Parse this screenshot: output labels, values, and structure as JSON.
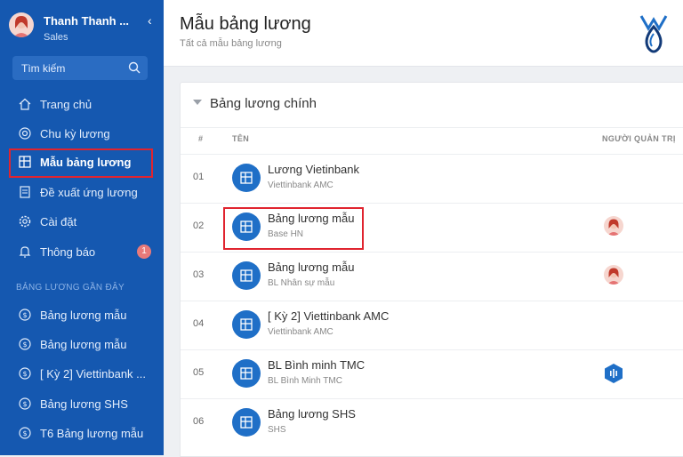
{
  "sidebar": {
    "user_name": "Thanh Thanh ...",
    "user_role": "Sales",
    "search_placeholder": "Tìm kiếm",
    "nav": [
      {
        "label": "Trang chủ",
        "icon": "home-icon"
      },
      {
        "label": "Chu kỳ lương",
        "icon": "cycle-icon"
      },
      {
        "label": "Mẫu bảng lương",
        "icon": "table-icon"
      },
      {
        "label": "Đề xuất ứng lương",
        "icon": "document-icon"
      },
      {
        "label": "Cài đặt",
        "icon": "gear-icon"
      },
      {
        "label": "Thông báo",
        "icon": "bell-icon",
        "badge": "1"
      }
    ],
    "recent_title": "BẢNG LƯƠNG GẦN ĐÂY",
    "recent": [
      {
        "label": "Bảng lương mẫu",
        "icon": "dollar-icon"
      },
      {
        "label": "Bảng lương mẫu",
        "icon": "dollar-icon"
      },
      {
        "label": "[ Kỳ 2] Viettinbank ...",
        "icon": "dollar-icon"
      },
      {
        "label": "Bảng lương SHS",
        "icon": "dollar-icon"
      },
      {
        "label": "T6 Bảng lương mẫu",
        "icon": "dollar-icon"
      }
    ]
  },
  "header": {
    "title": "Mẫu bảng lương",
    "subtitle": "Tất cả mẫu bảng lương"
  },
  "card": {
    "title": "Bảng lương chính",
    "columns": {
      "no": "#",
      "name": "TÊN",
      "admin": "NGƯỜI QUẢN TRỊ"
    },
    "rows": [
      {
        "no": "01",
        "name": "Lương Vietinbank",
        "sub": "Viettinbank AMC",
        "admin": ""
      },
      {
        "no": "02",
        "name": "Bảng lương mẫu",
        "sub": "Base HN",
        "admin": "avatar-woman"
      },
      {
        "no": "03",
        "name": "Bảng lương mẫu",
        "sub": "BL Nhân sự mẫu",
        "admin": "avatar-woman"
      },
      {
        "no": "04",
        "name": "[ Kỳ 2] Viettinbank AMC",
        "sub": "Viettinbank AMC",
        "admin": ""
      },
      {
        "no": "05",
        "name": "BL Bình minh TMC",
        "sub": "BL Bình Minh TMC",
        "admin": "hexagon-logo"
      },
      {
        "no": "06",
        "name": "Bảng lương SHS",
        "sub": "SHS",
        "admin": ""
      }
    ]
  },
  "colors": {
    "sidebar": "#1558b0",
    "accent": "#1f6fc7",
    "highlight": "#e0242f"
  }
}
